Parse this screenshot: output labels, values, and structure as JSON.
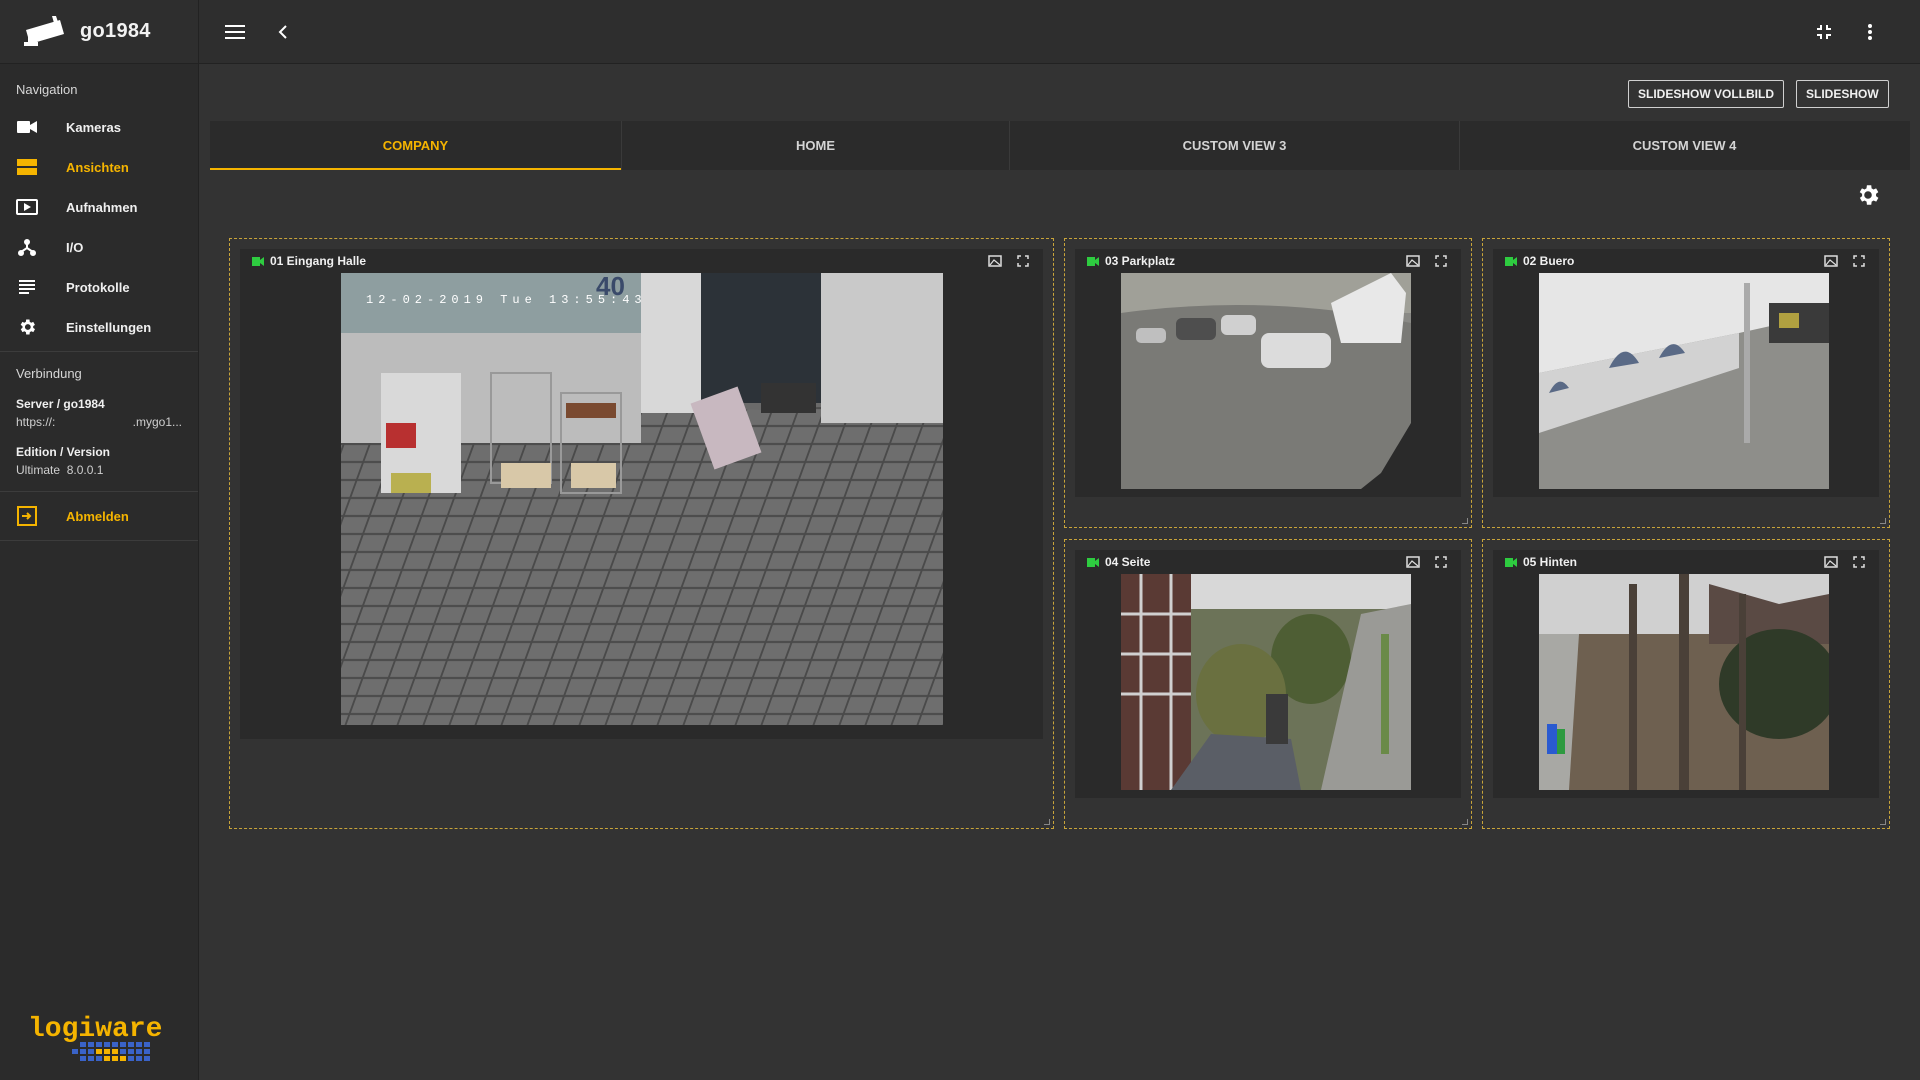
{
  "app": {
    "title": "go1984"
  },
  "sidebar": {
    "navigation_label": "Navigation",
    "items": [
      {
        "label": "Kameras",
        "icon": "video-camera-icon"
      },
      {
        "label": "Ansichten",
        "icon": "view-list-icon",
        "active": true
      },
      {
        "label": "Aufnahmen",
        "icon": "recordings-icon"
      },
      {
        "label": "I/O",
        "icon": "io-network-icon"
      },
      {
        "label": "Protokolle",
        "icon": "logs-icon"
      },
      {
        "label": "Einstellungen",
        "icon": "gear-icon"
      }
    ],
    "connection_label": "Verbindung",
    "server_label": "Server / go1984",
    "server_url_start": "https://:",
    "server_url_end": ".mygo1...",
    "edition_label": "Edition / Version",
    "edition_value": "Ultimate",
    "version_value": "8.0.0.1",
    "logout_label": "Abmelden",
    "footer_logo": "logiware"
  },
  "toolbar": {
    "slideshow_fullscreen_label": "SLIDESHOW VOLLBILD",
    "slideshow_label": "SLIDESHOW"
  },
  "tabs": [
    {
      "label": "COMPANY",
      "active": true
    },
    {
      "label": "HOME"
    },
    {
      "label": "CUSTOM VIEW 3"
    },
    {
      "label": "CUSTOM VIEW 4"
    }
  ],
  "cameras": [
    {
      "name": "01 Eingang Halle",
      "osd": "12-02-2019 Tue 13:55:43",
      "osd_number": "40"
    },
    {
      "name": "03 Parkplatz"
    },
    {
      "name": "02 Buero"
    },
    {
      "name": "04 Seite"
    },
    {
      "name": "05 Hinten"
    }
  ],
  "colors": {
    "accent": "#f5b400",
    "camera_active": "#2ecc40",
    "background": "#333333",
    "sidebar": "#2b2b2b",
    "cell_border": "#c8a43a"
  }
}
